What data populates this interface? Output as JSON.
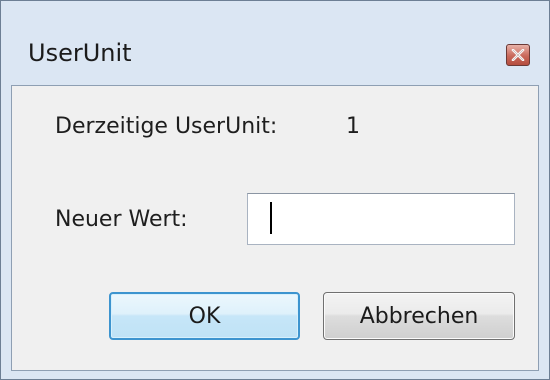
{
  "window": {
    "title": "UserUnit",
    "close_icon": "close-icon"
  },
  "dialog": {
    "current_label": "Derzeitige UserUnit:",
    "current_value": "1",
    "new_label": "Neuer Wert:",
    "new_value": "",
    "placeholder": ""
  },
  "buttons": {
    "ok_label": "OK",
    "cancel_label": "Abbrechen"
  },
  "colors": {
    "frame": "#dbe6f3",
    "client": "#f0f0f0",
    "close_red": "#c9685a",
    "focus_blue": "#3d94cf"
  }
}
